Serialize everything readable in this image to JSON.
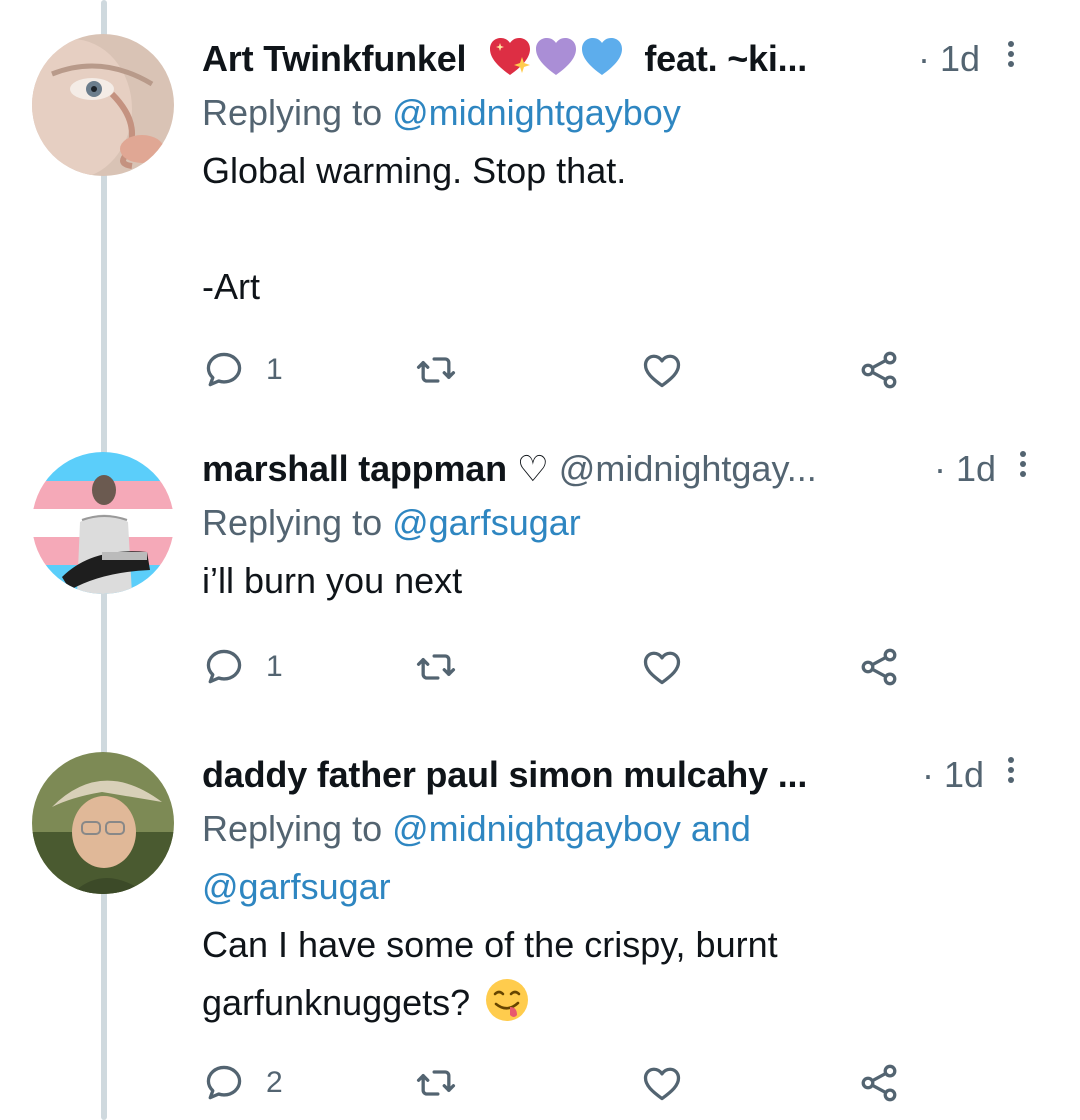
{
  "tweets": [
    {
      "name": "Art Twinkfunkel",
      "emojis": [
        "sparkling-heart",
        "purple-heart",
        "blue-heart"
      ],
      "name_suffix": "feat. ~ki...",
      "handle": "",
      "time": "· 1d",
      "replying_prefix": "Replying to ",
      "replying_to": "@midnightgayboy",
      "replying_to_line2": "",
      "text": "Global warming. Stop that.\n\n-Art",
      "reply_count": "1",
      "retweet_count": "",
      "like_count": ""
    },
    {
      "name": "marshall tappman ♡",
      "handle": "@midnightgay...",
      "time": "· 1d",
      "replying_prefix": "Replying to ",
      "replying_to": "@garfsugar",
      "text": "i’ll burn you next",
      "reply_count": "1"
    },
    {
      "name": "daddy father paul simon mulcahy ...",
      "handle": "",
      "time": "· 1d",
      "replying_prefix": "Replying to ",
      "replying_to": "@midnightgayboy and",
      "replying_to_line2": "@garfsugar",
      "text": "Can I have some of the crispy, burnt garfunknuggets?",
      "text_emoji": "face-savoring-food",
      "reply_count": "2"
    }
  ],
  "colors": {
    "link": "#2e86c1",
    "secondary": "#536471",
    "thread_line": "#cfd9de"
  }
}
